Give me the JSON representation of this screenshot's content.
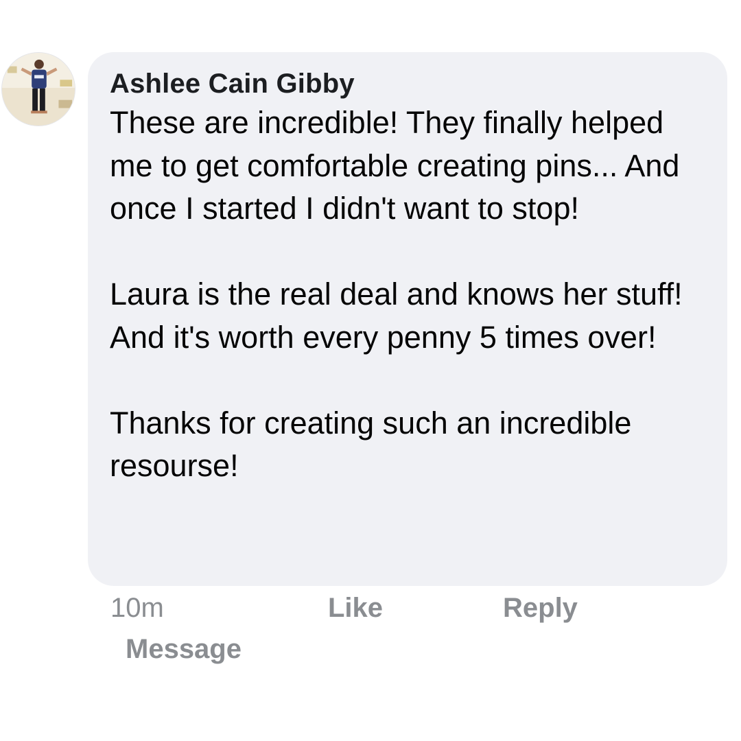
{
  "comment": {
    "author": "Ashlee Cain Gibby",
    "paragraphs": [
      "These are incredible! They finally helped me to get comfortable creating pins... And once I started I didn't want to stop!",
      "Laura is the real deal and knows her stuff! And it's worth every penny 5 times over!",
      "Thanks for creating such an incredible resourse!"
    ],
    "avatar_icon": "profile-photo",
    "bubble_color": "#f0f1f5"
  },
  "actions": {
    "timestamp": "10m",
    "like_label": "Like",
    "reply_label": "Reply",
    "message_label": "Message",
    "muted_color": "#8a8d91"
  }
}
